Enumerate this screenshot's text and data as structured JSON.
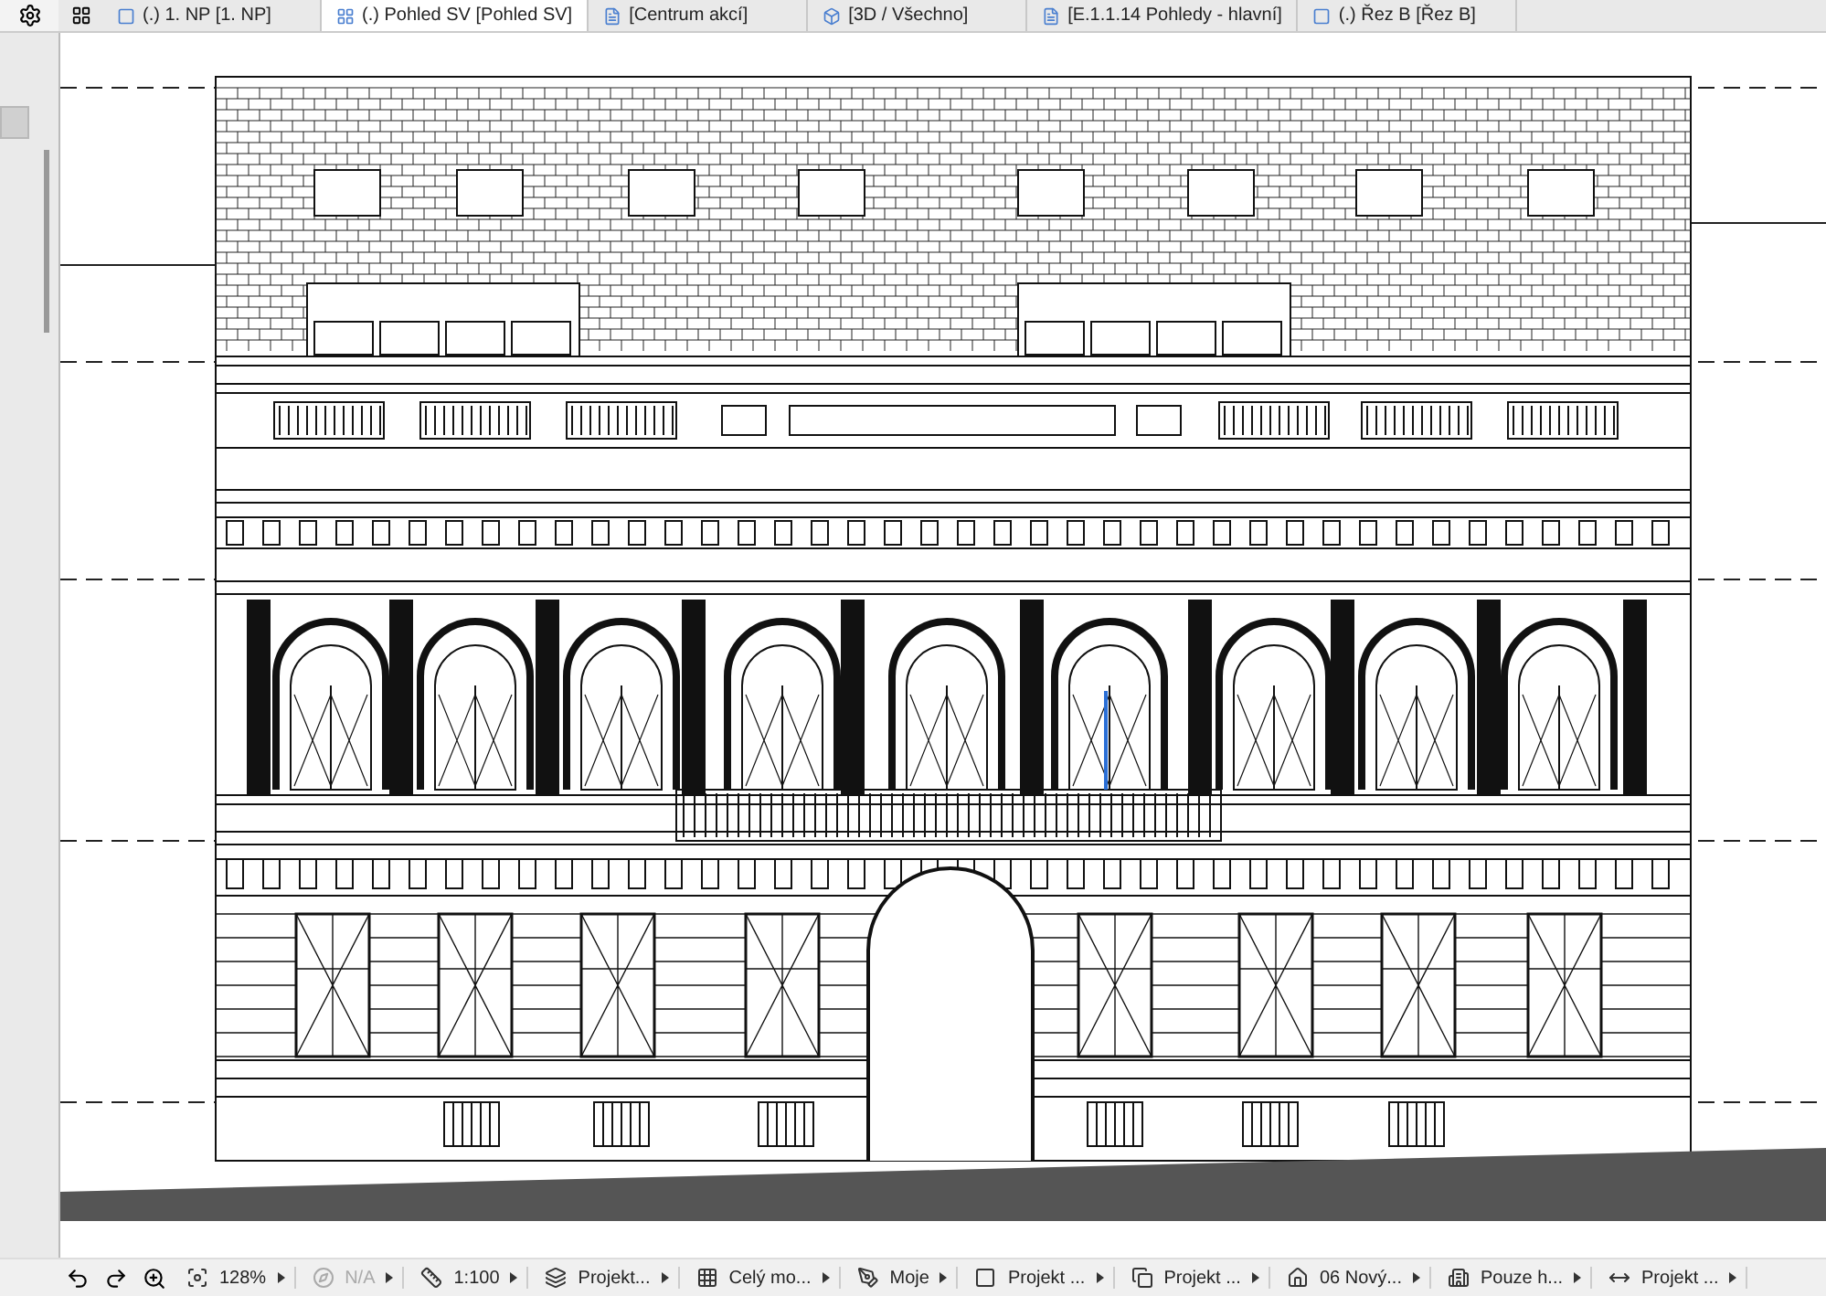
{
  "tabs": [
    {
      "label": "(.) 1. NP [1. NP]",
      "selected": false,
      "kind": "floor"
    },
    {
      "label": "(.) Pohled SV [Pohled SV]",
      "selected": true,
      "kind": "elevation"
    },
    {
      "label": "[Centrum akcí]",
      "selected": false,
      "kind": "action"
    },
    {
      "label": "[3D / Všechno]",
      "selected": false,
      "kind": "model"
    },
    {
      "label": "[E.1.1.14 Pohledy - hlavní]",
      "selected": false,
      "kind": "layout"
    },
    {
      "label": "(.) Řez B [Řez B]",
      "selected": false,
      "kind": "section"
    }
  ],
  "status_bar": [
    {
      "kind": "undo"
    },
    {
      "kind": "redo"
    },
    {
      "kind": "zoom"
    },
    {
      "kind": "fit",
      "label": "128%",
      "disabled": false
    },
    {
      "kind": "orient",
      "label": "N/A",
      "disabled": true
    },
    {
      "kind": "scale",
      "label": "1:100",
      "disabled": false
    },
    {
      "kind": "layers",
      "label": "Projekt...",
      "disabled": false
    },
    {
      "kind": "model",
      "label": "Celý mo...",
      "disabled": false
    },
    {
      "kind": "pen",
      "label": "Moje",
      "disabled": false
    },
    {
      "kind": "view",
      "label": "Projekt ...",
      "disabled": false
    },
    {
      "kind": "override",
      "label": "Projekt ...",
      "disabled": false
    },
    {
      "kind": "reno",
      "label": "06 Nový...",
      "disabled": false
    },
    {
      "kind": "struct",
      "label": "Pouze h...",
      "disabled": false
    },
    {
      "kind": "dim",
      "label": "Projekt ...",
      "disabled": false
    }
  ]
}
